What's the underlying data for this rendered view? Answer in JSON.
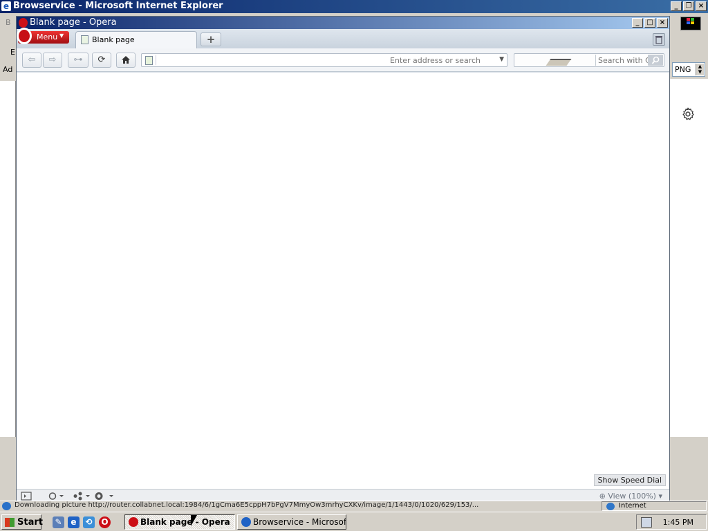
{
  "ie": {
    "title": "Browservice - Microsoft Internet Explorer",
    "left_labels": [
      "B",
      "E",
      "Ad"
    ],
    "format_select": "PNG",
    "status_text": "Downloading picture http://router.collabnet.local:1984/6/1gCma6E5cppH7bPgV7MmyOw3mrhyCXKv/image/1/1443/0/1020/629/153/...",
    "zone": "Internet"
  },
  "opera": {
    "title": "Blank page - Opera",
    "menu_label": "Menu",
    "tab_title": "Blank page",
    "new_tab": "+",
    "address": {
      "value": "",
      "placeholder": "Enter address or search"
    },
    "search": {
      "placeholder": "Search with Co"
    },
    "speed_dial_label": "Show Speed Dial",
    "zoom_label": "View (100%)"
  },
  "taskbar": {
    "start_label": "Start",
    "tasks": [
      {
        "label": "Blank page - Opera",
        "active": true
      },
      {
        "label": "Browservice - Microsof...",
        "active": false
      }
    ],
    "clock": "1:45 PM"
  },
  "colors": {
    "titlebar": "#0a246a",
    "opera_red": "#cc0f16",
    "window_face": "#d4d0c8"
  }
}
